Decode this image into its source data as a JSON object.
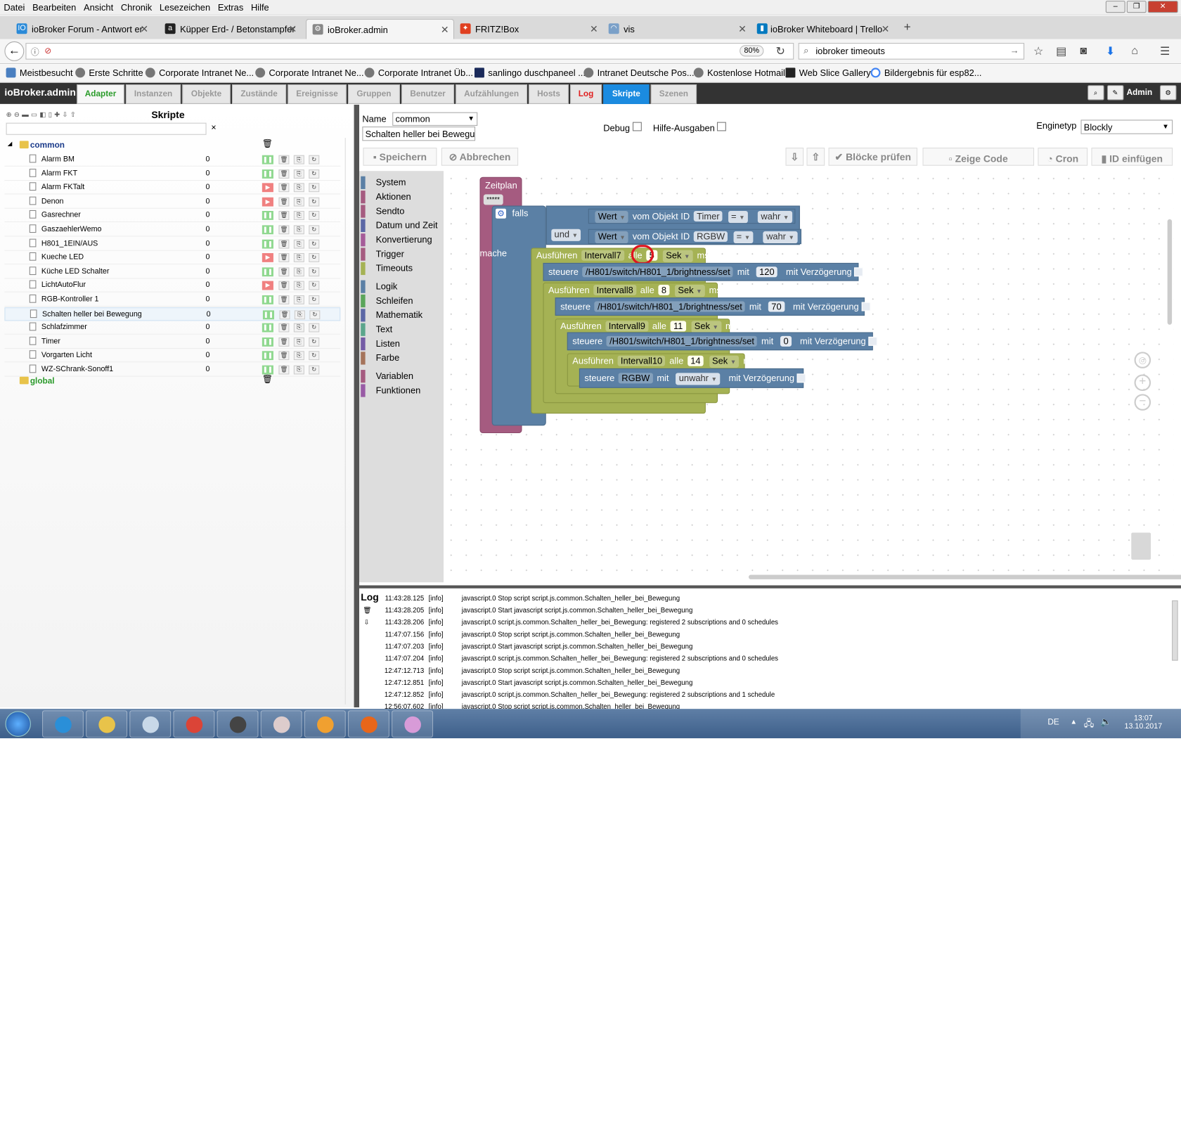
{
  "browser": {
    "menu": [
      "Datei",
      "Bearbeiten",
      "Ansicht",
      "Chronik",
      "Lesezeichen",
      "Extras",
      "Hilfe"
    ],
    "tabs": [
      {
        "label": "ioBroker Forum - Antwort er"
      },
      {
        "label": "Küpper Erd- / Betonstampfer"
      },
      {
        "label": "ioBroker.admin"
      },
      {
        "label": "FRITZ!Box"
      },
      {
        "label": "vis"
      },
      {
        "label": "ioBroker Whiteboard | Trello"
      }
    ],
    "new_tab": "+",
    "zoom": "80%",
    "search": "iobroker timeouts",
    "bookmarks": [
      "Meistbesucht",
      "Erste Schritte",
      "Corporate Intranet Ne...",
      "Corporate Intranet Ne...",
      "Corporate Intranet Üb...",
      "sanlingo duschpaneel ...",
      "Intranet Deutsche Pos...",
      "Kostenlose Hotmail",
      "Web Slice Gallery",
      "Bildergebnis für esp82..."
    ]
  },
  "app": {
    "title": "ioBroker.admin",
    "tabs": [
      "Adapter",
      "Instanzen",
      "Objekte",
      "Zustände",
      "Ereignisse",
      "Gruppen",
      "Benutzer",
      "Aufzählungen",
      "Hosts",
      "Log",
      "Skripte",
      "Szenen"
    ],
    "user": "Admin"
  },
  "scripts": {
    "title": "Skripte",
    "folders": [
      "common",
      "global"
    ],
    "items": [
      {
        "name": "Alarm BM",
        "count": "0",
        "state": "run"
      },
      {
        "name": "Alarm FKT",
        "count": "0",
        "state": "run"
      },
      {
        "name": "Alarm FKTalt",
        "count": "0",
        "state": "stop"
      },
      {
        "name": "Denon",
        "count": "0",
        "state": "stop"
      },
      {
        "name": "Gasrechner",
        "count": "0",
        "state": "run"
      },
      {
        "name": "GaszaehlerWemo",
        "count": "0",
        "state": "run"
      },
      {
        "name": "H801_1EIN/AUS",
        "count": "0",
        "state": "run"
      },
      {
        "name": "Kueche LED",
        "count": "0",
        "state": "stop"
      },
      {
        "name": "Küche LED Schalter",
        "count": "0",
        "state": "run"
      },
      {
        "name": "LichtAutoFlur",
        "count": "0",
        "state": "stop"
      },
      {
        "name": "RGB-Kontroller 1",
        "count": "0",
        "state": "run"
      },
      {
        "name": "Schalten heller bei Bewegung",
        "count": "0",
        "state": "run"
      },
      {
        "name": "Schlafzimmer",
        "count": "0",
        "state": "run"
      },
      {
        "name": "Timer",
        "count": "0",
        "state": "run"
      },
      {
        "name": "Vorgarten Licht",
        "count": "0",
        "state": "run"
      },
      {
        "name": "WZ-SChrank-Sonoff1",
        "count": "0",
        "state": "run"
      }
    ]
  },
  "editor": {
    "name_label": "Name",
    "name_value": "common",
    "script_name": "Schalten heller bei Bewegu",
    "debug_label": "Debug",
    "hilfe_label": "Hilfe-Ausgaben",
    "engine_label": "Enginetyp",
    "engine_value": "Blockly",
    "save": "Speichern",
    "cancel": "Abbrechen",
    "check": "Blöcke prüfen",
    "showcode": "Zeige Code",
    "cron": "Cron",
    "insert_id": "ID einfügen"
  },
  "toolbox": [
    {
      "label": "System",
      "color": "#5b80a5"
    },
    {
      "label": "Aktionen",
      "color": "#a55b80"
    },
    {
      "label": "Sendto",
      "color": "#a55b80"
    },
    {
      "label": "Datum und Zeit",
      "color": "#5b67a5"
    },
    {
      "label": "Konvertierung",
      "color": "#a55b99"
    },
    {
      "label": "Trigger",
      "color": "#a55b80"
    },
    {
      "label": "Timeouts",
      "color": "#a5b254"
    },
    {
      "label": "Logik",
      "color": "#5b80a5"
    },
    {
      "label": "Schleifen",
      "color": "#5ba55b"
    },
    {
      "label": "Mathematik",
      "color": "#5b67a5"
    },
    {
      "label": "Text",
      "color": "#5ba58c"
    },
    {
      "label": "Listen",
      "color": "#745ba5"
    },
    {
      "label": "Farbe",
      "color": "#a5745b"
    },
    {
      "label": "Variablen",
      "color": "#a55b80"
    },
    {
      "label": "Funktionen",
      "color": "#995ba5"
    }
  ],
  "blocks": {
    "schedule": "Zeitplan",
    "cron": "*****",
    "if": "falls",
    "and": "und",
    "do": "mache",
    "value": "Wert",
    "of_object": "vom Objekt ID",
    "obj1": "Timer",
    "obj2": "RGBW",
    "eq": "=",
    "true": "wahr",
    "false": "unwahr",
    "run": "Ausführen",
    "every": "alle",
    "sec": "Sek",
    "ms": "ms",
    "control": "steuere",
    "with": "mit",
    "delay": "mit Verzögerung",
    "path": "/H801/switch/H801_1/brightness/set",
    "intervals": [
      {
        "name": "Intervall7",
        "every": "5",
        "value": "120"
      },
      {
        "name": "Intervall8",
        "every": "8",
        "value": "70"
      },
      {
        "name": "Intervall9",
        "every": "11",
        "value": "0"
      },
      {
        "name": "Intervall10",
        "every": "14",
        "value": "RGBW"
      }
    ]
  },
  "log": {
    "title": "Log",
    "lines": [
      {
        "time": "11:43:28.125",
        "level": "[info]",
        "msg": "javascript.0 Stop script script.js.common.Schalten_heller_bei_Bewegung"
      },
      {
        "time": "11:43:28.205",
        "level": "[info]",
        "msg": "javascript.0 Start javascript script.js.common.Schalten_heller_bei_Bewegung"
      },
      {
        "time": "11:43:28.206",
        "level": "[info]",
        "msg": "javascript.0 script.js.common.Schalten_heller_bei_Bewegung: registered 2 subscriptions and 0 schedules"
      },
      {
        "time": "11:47:07.156",
        "level": "[info]",
        "msg": "javascript.0 Stop script script.js.common.Schalten_heller_bei_Bewegung"
      },
      {
        "time": "11:47:07.203",
        "level": "[info]",
        "msg": "javascript.0 Start javascript script.js.common.Schalten_heller_bei_Bewegung"
      },
      {
        "time": "11:47:07.204",
        "level": "[info]",
        "msg": "javascript.0 script.js.common.Schalten_heller_bei_Bewegung: registered 2 subscriptions and 0 schedules"
      },
      {
        "time": "12:47:12.713",
        "level": "[info]",
        "msg": "javascript.0 Stop script script.js.common.Schalten_heller_bei_Bewegung"
      },
      {
        "time": "12:47:12.851",
        "level": "[info]",
        "msg": "javascript.0 Start javascript script.js.common.Schalten_heller_bei_Bewegung"
      },
      {
        "time": "12:47:12.852",
        "level": "[info]",
        "msg": "javascript.0 script.js.common.Schalten_heller_bei_Bewegung: registered 2 subscriptions and 1 schedule"
      },
      {
        "time": "12:56:07.602",
        "level": "[info]",
        "msg": "javascript.0 Stop script script.js.common.Schalten_heller_bei_Bewegung"
      }
    ]
  },
  "taskbar": {
    "lang": "DE",
    "time": "13:07",
    "date": "13.10.2017",
    "apps": [
      "ie-icon",
      "explorer-icon",
      "calculator-icon",
      "chrome-icon",
      "barcode-icon",
      "handshake-icon",
      "outlook-icon",
      "firefox-icon",
      "paint-icon"
    ]
  }
}
